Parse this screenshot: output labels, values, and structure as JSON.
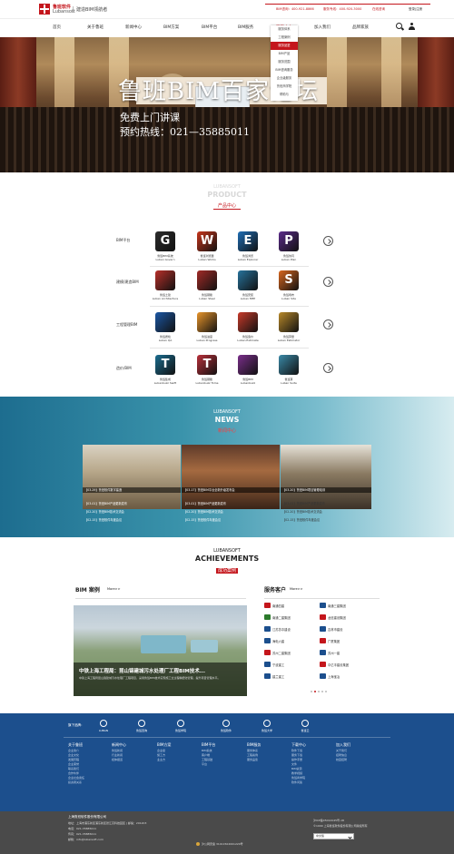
{
  "brand": {
    "name_cn": "鲁班软件",
    "name_en": "Lubansoft",
    "slogan": "建造BIM领航者",
    "hotline1": "BIM咨询：400-921-8866",
    "hotline2": "服务专线：400-920-3000",
    "tools": "在线咨询",
    "login": "登录|注册",
    "accent": "#c4161c"
  },
  "nav": {
    "items": [
      "首页",
      "关于鲁班",
      "新闻中心",
      "BIM方案",
      "BIM平台",
      "BIM服务",
      "下载中心",
      "加入我们",
      "品牌家族"
    ],
    "active_index": 6
  },
  "dropdown": {
    "items": [
      "服务体系",
      "工程案例",
      "服务品鉴",
      "BIM产品",
      "服务范围",
      "BIM咨询服务",
      "企业级服务",
      "鲁班商学院",
      "帮助与"
    ],
    "highlight_index": 2
  },
  "hero": {
    "title": "鲁班BIM百家论坛",
    "line1": "免费上门讲课",
    "line2": "预约热线：021—35885011"
  },
  "products": {
    "en_title": "LUBANSOFT",
    "en_title2": "PRODUCT",
    "cn_title": "产品中心",
    "rows": [
      {
        "category": "BIM平台",
        "items": [
          {
            "name": "鲁班BIM系统",
            "sub": "Luban Govern",
            "color": "#2c2c2c",
            "icon": "G"
          },
          {
            "name": "鲁班浏览器",
            "sub": "Luban Works",
            "color": "#c8361c",
            "icon": "W"
          },
          {
            "name": "鲁班浏览",
            "sub": "Luban Explorer",
            "color": "#1f6eb5",
            "icon": "E"
          },
          {
            "name": "鲁班协同",
            "sub": "Luban Plan",
            "color": "#5b2b8a",
            "icon": "P"
          }
        ]
      },
      {
        "category": "建模/建造BIM",
        "items": [
          {
            "name": "鲁班土建",
            "sub": "Luban Architecture",
            "color": "#b8302a",
            "icon": ""
          },
          {
            "name": "鲁班钢筋",
            "sub": "Luban Steel",
            "color": "#a22b27",
            "icon": ""
          },
          {
            "name": "鲁班安装",
            "sub": "Luban MEP",
            "color": "#27739c",
            "icon": ""
          },
          {
            "name": "鲁班场布",
            "sub": "Luban Site",
            "color": "#d8661e",
            "icon": "S"
          }
        ]
      },
      {
        "category": "工程管理BIM",
        "items": [
          {
            "name": "鲁班质检",
            "sub": "Luban QA",
            "color": "#1b57a4",
            "icon": ""
          },
          {
            "name": "鲁班进度",
            "sub": "Luban Progress",
            "color": "#e8952a",
            "icon": ""
          },
          {
            "name": "鲁班造价",
            "sub": "Luban Estimate",
            "color": "#c83a2a",
            "icon": ""
          },
          {
            "name": "鲁班算量",
            "sub": "Luban Estimator",
            "color": "#b8892a",
            "icon": ""
          }
        ]
      },
      {
        "category": "造价/BIM",
        "items": [
          {
            "name": "鲁班集成",
            "sub": "Lubanbuzz Swift",
            "color": "#1b6d8f",
            "icon": "T"
          },
          {
            "name": "鲁班钢筋",
            "sub": "Lubanbuzz Tome",
            "color": "#b8303a",
            "icon": "T"
          },
          {
            "name": "鲁班BIM",
            "sub": "Lubanbuzz",
            "color": "#7a2e8a",
            "icon": ""
          },
          {
            "name": "鲁班算",
            "sub": "Luban Suite",
            "color": "#3a8aa8",
            "icon": ""
          }
        ]
      }
    ]
  },
  "news": {
    "en_title": "LUBANSOFT",
    "en_title2": "NEWS",
    "cn_title": "新闻中心",
    "items": [
      {
        "caption": "【03-29】鲁班软件数字建造",
        "subs": [
          "【03-01】鲁班BIM产品更新发布",
          "【02-20】鲁班BIM技术交流会",
          "【02-15】鲁班软件年度会议"
        ]
      },
      {
        "caption": "【03-17】鲁班BIM平台全新升级发布会",
        "subs": [
          "【03-01】鲁班BIM产品更新发布",
          "【02-20】鲁班BIM技术交流会",
          "【02-15】鲁班软件年度会议"
        ]
      },
      {
        "caption": "【03-20】鲁班BIM项目管理培训",
        "subs": [
          "【03-01】鲁班BIM产品更新发布",
          "【02-20】鲁班BIM技术交流会",
          "【02-15】鲁班软件年度会议"
        ]
      }
    ]
  },
  "achievements": {
    "en_title": "LUBANSOFT",
    "en_title2": "ACHIEVEMENTS",
    "cn_title": "成功案例",
    "bim_title": "BIM 案例",
    "bim_more": "More>>",
    "case_title": "中铁上海工程局：昆山锦建城污水处理厂工程BIM技术...",
    "case_desc": "中铁上海工程局昆山锦建城污水处理厂工程项目，采用鲁班BIM技术实现施工全过程精细化管理，提升项目管理水平。",
    "svc_title": "服务客户",
    "svc_more": "More>>",
    "clients": [
      {
        "name": "南通四建",
        "color": "#c4161c"
      },
      {
        "name": "南通三建集团",
        "color": "#1c4f8d"
      },
      {
        "name": "南通二建集团",
        "color": "#2b7a2b"
      },
      {
        "name": "龙信建设集团",
        "color": "#c4161c"
      },
      {
        "name": "江苏苏中建设",
        "color": "#1c4f8d"
      },
      {
        "name": "吉林市建设",
        "color": "#1c4f8d"
      },
      {
        "name": "海电六建",
        "color": "#1c4f8d"
      },
      {
        "name": "广厦集团",
        "color": "#c4161c"
      },
      {
        "name": "苏州二建集团",
        "color": "#c4161c"
      },
      {
        "name": "苏州一建",
        "color": "#1c4f8d"
      },
      {
        "name": "宁波建工",
        "color": "#1c4f8d"
      },
      {
        "name": "中亿丰建设集团",
        "color": "#c4161c"
      },
      {
        "name": "建兰建工",
        "color": "#1c4f8d"
      },
      {
        "name": "上海宝冶",
        "color": "#1c4f8d"
      }
    ]
  },
  "partners": {
    "label": "旗下品牌：",
    "items": [
      "LUBAN",
      "鲁班咨询",
      "鲁班学院",
      "鲁班软件",
      "鲁班大学",
      "鲁班云"
    ]
  },
  "footer_cols": [
    {
      "head": "关于鲁班",
      "items": [
        "企业简介",
        "企业文化",
        "发展历程",
        "企业荣誉",
        "联系我们",
        "合作伙伴",
        "企业社会责任",
        "投资者关系"
      ]
    },
    {
      "head": "新闻中心",
      "items": [
        "鲁班新闻",
        "行业新闻",
        "媒体报道"
      ]
    },
    {
      "head": "BIM方案",
      "items": [
        "企业级",
        "施工方",
        "业主方"
      ]
    },
    {
      "head": "BIM平台",
      "items": [
        "BIM系统",
        "客户端",
        "工程基础",
        "平台"
      ]
    },
    {
      "head": "BIM服务",
      "items": [
        "服务体系",
        "工程案例",
        "服务品鉴"
      ]
    },
    {
      "head": "下载中心",
      "items": [
        "软件下载",
        "服务下载",
        "操作手册",
        "文件",
        "BIM资源",
        "教学视频",
        "鲁班商学院",
        "软件问答"
      ]
    },
    {
      "head": "加入我们",
      "items": [
        "关于我们",
        "招聘信息",
        "校园招聘"
      ]
    }
  ],
  "footer_bottom": {
    "company": "上海鲁班软件股份有限公司",
    "address": "地址：上海市浦东新区浦东新区张江高科技园区 | 邮编：201203",
    "tel": "电话：021-35885011",
    "fax": "传真：021-35885011",
    "mail": "邮箱：info@lubansoft.com",
    "icp1": "沪ICP备05012045号-18",
    "icp2": "©1999 上海鲁班软件股份有限公司版权所有",
    "police": "沪公网安备 31011502001220号",
    "lang": "中文版"
  }
}
